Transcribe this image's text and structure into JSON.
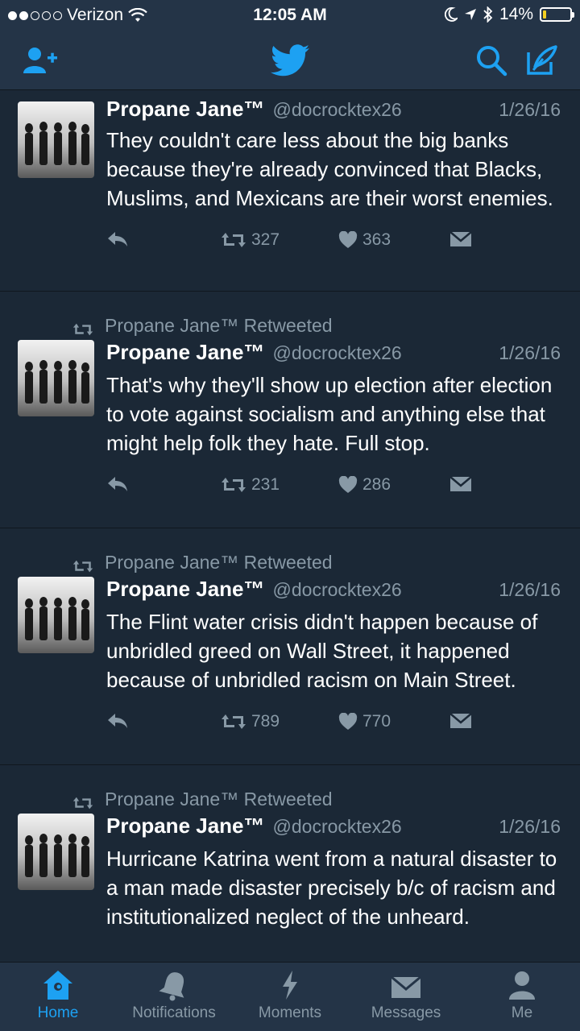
{
  "status_bar": {
    "carrier": "Verizon",
    "time": "12:05 AM",
    "battery": "14%",
    "battery_level": 0.14,
    "signal_bars": 2
  },
  "nav": {
    "add_user_icon": "add-user-icon",
    "logo_icon": "twitter-bird-icon",
    "search_icon": "search-icon",
    "compose_icon": "compose-icon"
  },
  "colors": {
    "background": "#1b2836",
    "bar": "#243447",
    "accent": "#1da1f2",
    "muted": "#8899a6"
  },
  "tweets": [
    {
      "retweet_label": "",
      "name": "Propane Jane™",
      "handle": "@docrocktex26",
      "date": "1/26/16",
      "text": "They couldn't care less about the big banks because they're already convinced that Blacks, Muslims, and Mexicans are their worst enemies.",
      "retweets": "327",
      "likes": "363"
    },
    {
      "retweet_label": "Propane Jane™ Retweeted",
      "name": "Propane Jane™",
      "handle": "@docrocktex26",
      "date": "1/26/16",
      "text": "That's why they'll show up election after election to vote against socialism and anything else that might help folk they hate. Full stop.",
      "retweets": "231",
      "likes": "286"
    },
    {
      "retweet_label": "Propane Jane™ Retweeted",
      "name": "Propane Jane™",
      "handle": "@docrocktex26",
      "date": "1/26/16",
      "text": "The Flint water crisis didn't happen because of unbridled greed on Wall Street, it happened because of unbridled racism on Main Street.",
      "retweets": "789",
      "likes": "770"
    },
    {
      "retweet_label": "Propane Jane™ Retweeted",
      "name": "Propane Jane™",
      "handle": "@docrocktex26",
      "date": "1/26/16",
      "text": "Hurricane Katrina went from a natural disaster to a man made disaster precisely b/c of racism and institutionalized neglect of the unheard.",
      "retweets": "",
      "likes": ""
    }
  ],
  "tabs": [
    {
      "label": "Home",
      "icon": "home-icon",
      "active": true
    },
    {
      "label": "Notifications",
      "icon": "bell-icon",
      "active": false
    },
    {
      "label": "Moments",
      "icon": "lightning-icon",
      "active": false
    },
    {
      "label": "Messages",
      "icon": "envelope-icon",
      "active": false
    },
    {
      "label": "Me",
      "icon": "person-icon",
      "active": false
    }
  ]
}
